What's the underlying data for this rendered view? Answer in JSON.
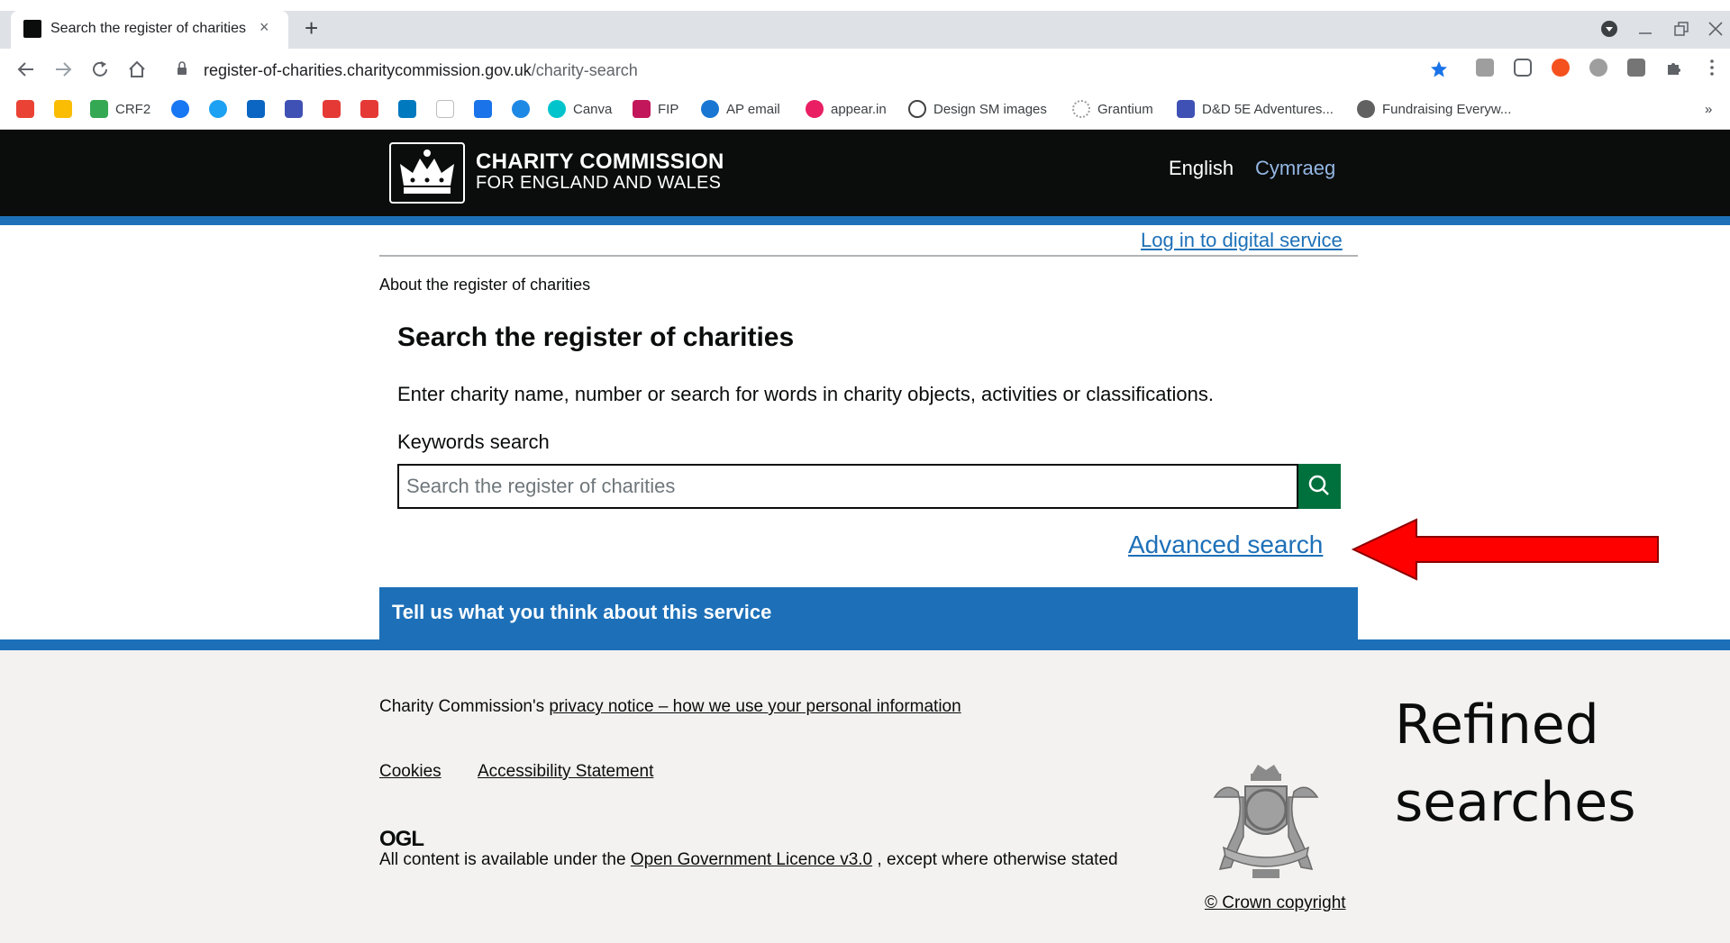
{
  "browser": {
    "tab_title": "Search the register of charities",
    "tab_close": "×",
    "new_tab": "+",
    "url_host": "register-of-charities.charitycommission.gov.uk",
    "url_path": "/charity-search",
    "bookmarks": [
      {
        "label": "",
        "color": "#ea4335"
      },
      {
        "label": "",
        "color": "#fbbc04"
      },
      {
        "label": "CRF2",
        "color": "#34a853"
      },
      {
        "label": "",
        "color": "#1877f2"
      },
      {
        "label": "",
        "color": "#1da1f2"
      },
      {
        "label": "",
        "color": "#0a66c2"
      },
      {
        "label": "",
        "color": "#3f51b5"
      },
      {
        "label": "",
        "color": "#e53935"
      },
      {
        "label": "",
        "color": "#e53935"
      },
      {
        "label": "",
        "color": "#0079bf"
      },
      {
        "label": "",
        "color": "#bdbdbd"
      },
      {
        "label": "",
        "color": "#1a73e8"
      },
      {
        "label": "",
        "color": "#1e88e5"
      },
      {
        "label": "Canva",
        "color": "#00c4cc"
      },
      {
        "label": "FIP",
        "color": "#c2185b"
      },
      {
        "label": "AP email",
        "color": "#1976d2"
      },
      {
        "label": "appear.in",
        "color": "#e91e63"
      },
      {
        "label": "Design SM images",
        "color": "#424242"
      },
      {
        "label": "Grantium",
        "color": "#9e9e9e"
      },
      {
        "label": "D&D 5E Adventures...",
        "color": "#3f51b5"
      },
      {
        "label": "Fundraising Everyw...",
        "color": "#616161"
      }
    ],
    "more_bookmarks": "»"
  },
  "header": {
    "logo_line1": "CHARITY COMMISSION",
    "logo_line2": "FOR ENGLAND AND WALES",
    "lang_english": "English",
    "lang_welsh": "Cymraeg"
  },
  "main": {
    "login_link": "Log in to digital service",
    "breadcrumb": "About the register of charities",
    "title": "Search the register of charities",
    "intro": "Enter charity name, number or search for words in charity objects, activities or classifications.",
    "keywords_label": "Keywords search",
    "search_placeholder": "Search the register of charities",
    "search_value": "",
    "advanced_search": "Advanced search",
    "feedback": "Tell us what you think about this service"
  },
  "footer": {
    "privacy_prefix": "Charity Commission's ",
    "privacy_link": "privacy notice – how we use your personal information",
    "cookies": "Cookies",
    "accessibility": "Accessibility Statement",
    "ogl": "OGL",
    "licence_prefix": "All content is available under the ",
    "licence_link": "Open Government Licence v3.0",
    "licence_suffix": " , except where otherwise stated",
    "crown_copyright": "© Crown copyright"
  },
  "annotation": {
    "line1": "Refined",
    "line2": "searches",
    "arrow_color": "#ff0000"
  },
  "colors": {
    "header_bg": "#0b0c0c",
    "brand_blue": "#1d70b8",
    "search_button": "#00703c",
    "footer_bg": "#f3f2f1"
  }
}
